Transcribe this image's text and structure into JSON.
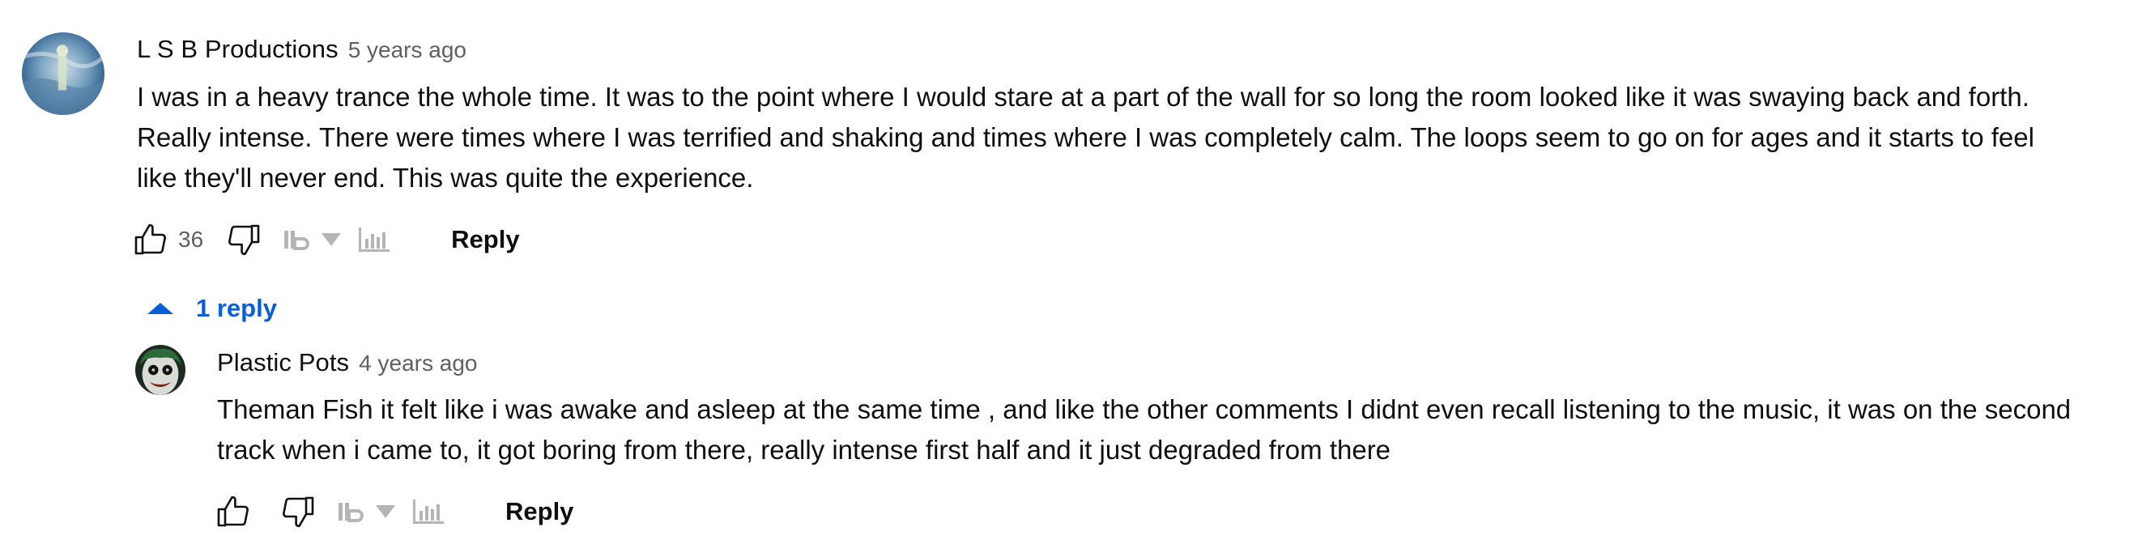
{
  "colors": {
    "text_primary": "#0f0f0f",
    "text_secondary": "#606060",
    "link_blue": "#065fd4",
    "ext_gray": "#b5b5b5"
  },
  "comments": [
    {
      "author": "L S B Productions",
      "timestamp": "5 years ago",
      "text": "I was in a heavy trance the whole time. It was to the point where I would stare at a part of the wall for so long the room looked like it was swaying back and forth. Really intense. There were times where I was terrified and shaking and times where I was completely calm. The loops seem to go on for ages and it starts to feel like they'll never end. This was quite the experience.",
      "likes": "36",
      "reply_label": "Reply",
      "icons": {
        "like": "thumbs-up-icon",
        "dislike": "thumbs-down-icon",
        "ext_logo": "ryd-logo-icon",
        "ext_dropdown": "triangle-down-icon",
        "ext_stats": "bar-chart-icon"
      }
    }
  ],
  "replies_toggle": {
    "label": "1 reply",
    "icon": "caret-up-icon"
  },
  "replies": [
    {
      "author": "Plastic Pots",
      "timestamp": "4 years ago",
      "text": "Theman Fish it felt like i was awake and asleep at the same time , and like the other comments I didnt even recall listening to the music, it was on the second track when i came to, it got boring from there, really intense first half and it just degraded from there",
      "reply_label": "Reply"
    }
  ]
}
